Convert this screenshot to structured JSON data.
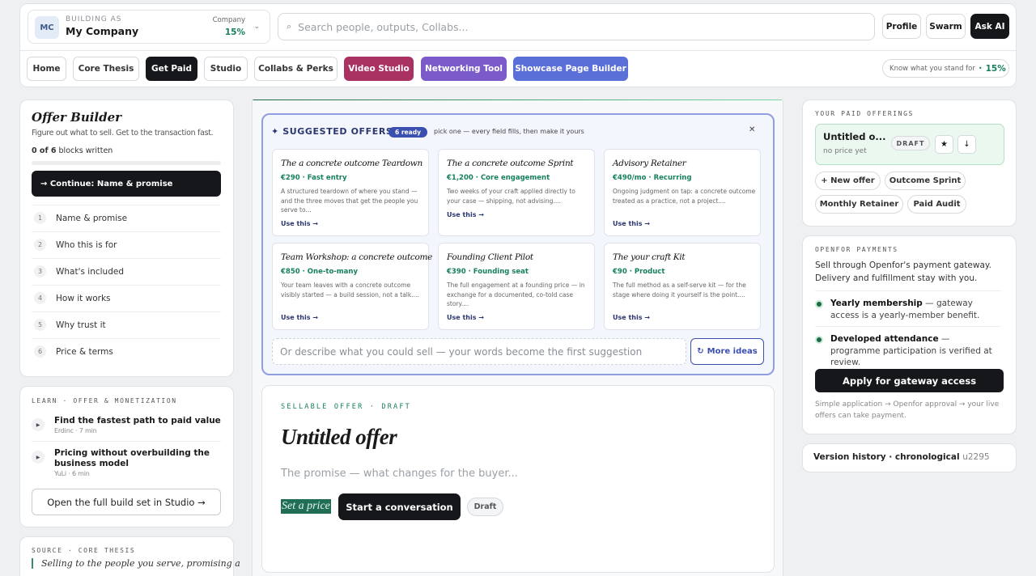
{
  "header": {
    "org": {
      "avatar": "MC",
      "kicker": "BUILDING AS",
      "name": "My Company",
      "company_label": "Company",
      "company_value": "15%",
      "chevron": "⌄"
    },
    "search": {
      "icon": "⌕",
      "placeholder": "Search people, outputs, Collabs..."
    },
    "buttons": {
      "profile": "Profile",
      "swarm": "Swarm",
      "ask_ai": "Ask AI"
    }
  },
  "nav": {
    "tabs": [
      "Home",
      "Core Thesis",
      "Get Paid",
      "Studio",
      "Collabs & Perks",
      "Video Studio",
      "Networking Tool",
      "Showcase Page Builder"
    ],
    "active": "Get Paid",
    "stand": {
      "label": "Know what you stand for",
      "dot": "•",
      "value": "15%"
    }
  },
  "offer_builder": {
    "title": "Offer Builder",
    "subtitle": "Figure out what to sell. Get to the transaction fast.",
    "count_bold": "0 of 6",
    "count_rest": " blocks written",
    "progress": 0,
    "continue_label": "→ Continue: Name & promise",
    "steps": [
      {
        "num": "1",
        "label": "Name & promise"
      },
      {
        "num": "2",
        "label": "Who this is for"
      },
      {
        "num": "3",
        "label": "What's included"
      },
      {
        "num": "4",
        "label": "How it works"
      },
      {
        "num": "5",
        "label": "Why trust it"
      },
      {
        "num": "6",
        "label": "Price & terms"
      }
    ]
  },
  "learn": {
    "label": "LEARN · OFFER & MONETIZATION",
    "items": [
      {
        "icon": "▶",
        "title": "Find the fastest path to paid value",
        "meta": "Erdinc · 7 min"
      },
      {
        "icon": "▶",
        "title": "Pricing without overbuilding the business model",
        "meta": "YuLi · 6 min"
      }
    ],
    "open_label": "Open the full build set in Studio →"
  },
  "source": {
    "label": "SOURCE · CORE THESIS",
    "quote": "Selling to the people you serve, promising a"
  },
  "suggested": {
    "title": "✦ SUGGESTED OFFERS",
    "badge": "6 ready",
    "hint": "pick one — every field fills, then make it yours",
    "close": "✕",
    "use_label": "Use this →",
    "cards": [
      {
        "title": "The a concrete outcome Teardown",
        "price": "€290 · Fast entry",
        "desc": "A structured teardown of where you stand — and the three moves that get the people you serve to..."
      },
      {
        "title": "The a concrete outcome Sprint",
        "price": "€1,200 · Core engagement",
        "desc": "Two weeks of your craft applied directly to your case — shipping, not advising...."
      },
      {
        "title": "Advisory Retainer",
        "price": "€490/mo · Recurring",
        "desc": "Ongoing judgment on tap: a concrete outcome treated as a practice, not a project...."
      },
      {
        "title": "Team Workshop: a concrete outcome",
        "price": "€850 · One-to-many",
        "desc": "Your team leaves with a concrete outcome visibly started — a build session, not a talk...."
      },
      {
        "title": "Founding Client Pilot",
        "price": "€390 · Founding seat",
        "desc": "The full engagement at a founding price — in exchange for a documented, co-told case story...."
      },
      {
        "title": "The your craft Kit",
        "price": "€90 · Product",
        "desc": "The full method as a self-serve kit — for the stage where doing it yourself is the point...."
      }
    ],
    "describe_placeholder": "Or describe what you could sell — your words become the first suggestion",
    "more_icon": "↻",
    "more_label": "More ideas"
  },
  "draft": {
    "label": "SELLABLE OFFER · DRAFT",
    "title": "Untitled offer",
    "promise_placeholder": "The promise — what changes for the buyer...",
    "set_price": "Set a price",
    "conversation": "Start a conversation",
    "status": "Draft"
  },
  "paid_offerings": {
    "label": "YOUR PAID OFFERINGS",
    "current": {
      "title": "Untitled o...",
      "price": "no price yet",
      "status": "DRAFT",
      "star": "★",
      "download": "↓"
    },
    "chips": [
      "+ New offer",
      "Outcome Sprint",
      "Monthly Retainer",
      "Paid Audit"
    ]
  },
  "payments": {
    "label": "OPENFOR PAYMENTS",
    "text": "Sell through Openfor's payment gateway. Delivery and fulfillment stay with you.",
    "bullets": [
      {
        "bold": "Yearly membership",
        "rest": " — gateway access is a yearly-member benefit."
      },
      {
        "bold": "Developed attendance",
        "rest": " — programme participation is verified at review."
      }
    ],
    "apply": "Apply for gateway access",
    "note": "Simple application → Openfor approval → your live offers can take payment."
  },
  "version_history": {
    "label": "Version history · chronological",
    "code": "u2295"
  },
  "colors": {
    "accent_green": "#16805a",
    "dark": "#15171a",
    "video_studio": "#a93263",
    "networking": "#7b5bc9",
    "showcase": "#5a6fd8"
  }
}
